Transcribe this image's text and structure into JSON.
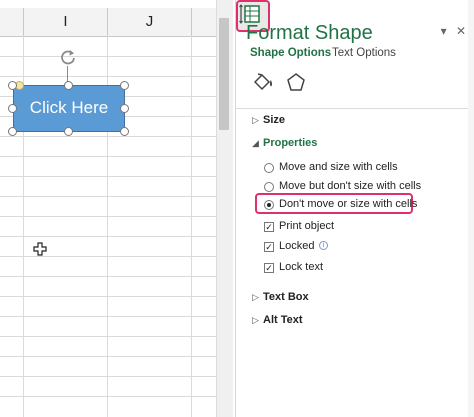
{
  "sheet": {
    "columns": [
      "I",
      "J"
    ],
    "shape_label": "Click Here"
  },
  "pane": {
    "title": "Format Shape",
    "dropdown_glyph": "▾",
    "close_glyph": "✕",
    "tabs": [
      {
        "label": "Shape Options",
        "active": true
      },
      {
        "label": "Text Options",
        "active": false
      }
    ],
    "icons": [
      "fill-line-icon",
      "effects-icon",
      "size-properties-icon"
    ],
    "sections": {
      "size": "Size",
      "properties": "Properties",
      "text_box": "Text Box",
      "alt_text": "Alt Text"
    },
    "properties": {
      "radio_options": [
        {
          "label": "Move and size with cells",
          "checked": false
        },
        {
          "label": "Move but don't size with cells",
          "checked": false
        },
        {
          "label": "Don't move or size with cells",
          "checked": true
        }
      ],
      "checkbox_options": [
        {
          "label": "Print object",
          "checked": true
        },
        {
          "label": "Locked",
          "checked": true
        },
        {
          "label": "Lock text",
          "checked": true
        }
      ]
    },
    "colors": {
      "accent": "#217346",
      "highlight": "#e0306a",
      "shape_fill": "#5b9bd5"
    }
  }
}
